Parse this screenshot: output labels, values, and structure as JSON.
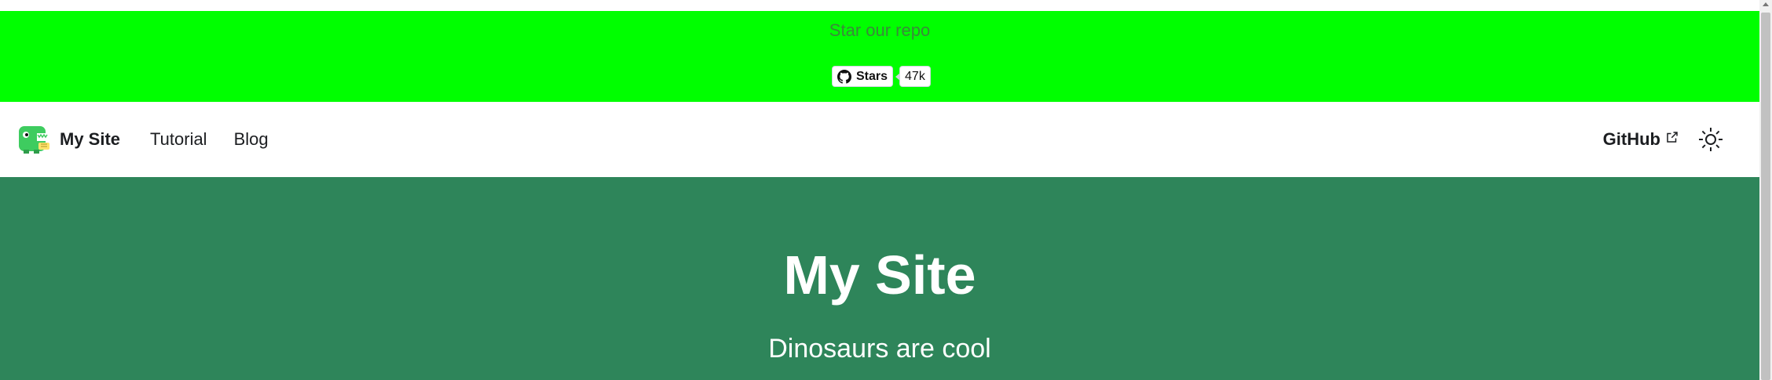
{
  "announcement": {
    "text": "Star our repo",
    "stars_label": "Stars",
    "stars_count": "47k",
    "background_color": "#00ff00",
    "icon": "github-icon"
  },
  "navbar": {
    "brand": "My Site",
    "logo_icon": "dinosaur-logo-icon",
    "links": [
      "Tutorial",
      "Blog"
    ],
    "github_label": "GitHub",
    "external_icon": "external-link-icon",
    "theme_icon": "sun-icon"
  },
  "hero": {
    "title": "My Site",
    "subtitle": "Dinosaurs are cool",
    "background_color": "#2e855a"
  },
  "scrollbar": {
    "up_icon": "scroll-up-arrow-icon"
  }
}
